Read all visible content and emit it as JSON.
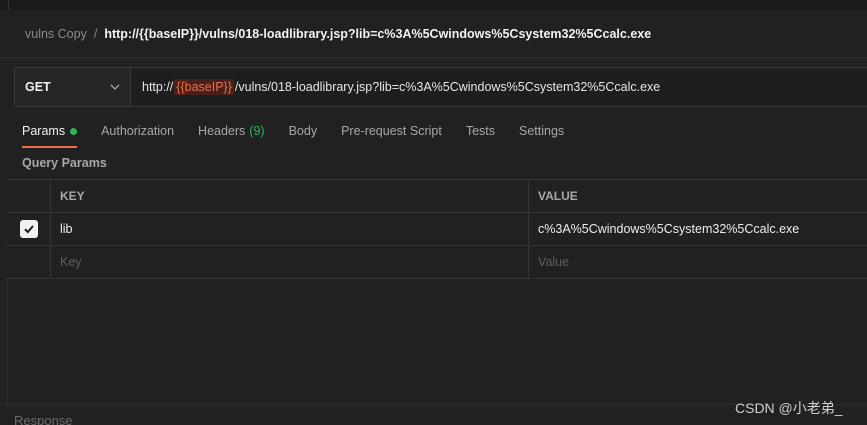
{
  "breadcrumb": {
    "parent": "vulns Copy",
    "separator": "/",
    "current": "http://{{baseIP}}/vulns/018-loadlibrary.jsp?lib=c%3A%5Cwindows%5Csystem32%5Ccalc.exe"
  },
  "request": {
    "method": "GET",
    "url_prefix": "http://",
    "url_variable": "{{baseIP}}",
    "url_suffix": "/vulns/018-loadlibrary.jsp?lib=c%3A%5Cwindows%5Csystem32%5Ccalc.exe"
  },
  "tabs": [
    {
      "label": "Params",
      "active": true
    },
    {
      "label": "Authorization"
    },
    {
      "label": "Headers",
      "count": "(9)"
    },
    {
      "label": "Body"
    },
    {
      "label": "Pre-request Script"
    },
    {
      "label": "Tests"
    },
    {
      "label": "Settings"
    }
  ],
  "query_params": {
    "title": "Query Params",
    "headers": {
      "key": "KEY",
      "value": "VALUE"
    },
    "rows": [
      {
        "key": "lib",
        "value": "c%3A%5Cwindows%5Csystem32%5Ccalc.exe",
        "checked": true
      }
    ],
    "placeholder": {
      "key": "Key",
      "value": "Value"
    }
  },
  "response": {
    "label": "Response"
  },
  "watermark": "CSDN @小老弟_",
  "colors": {
    "accent": "#e8704c",
    "active_dot": "#2fb65a",
    "background": "#212121"
  },
  "icons": {
    "method_dropdown": "chevron-down-icon",
    "param_checkbox": "checkmark-icon"
  }
}
